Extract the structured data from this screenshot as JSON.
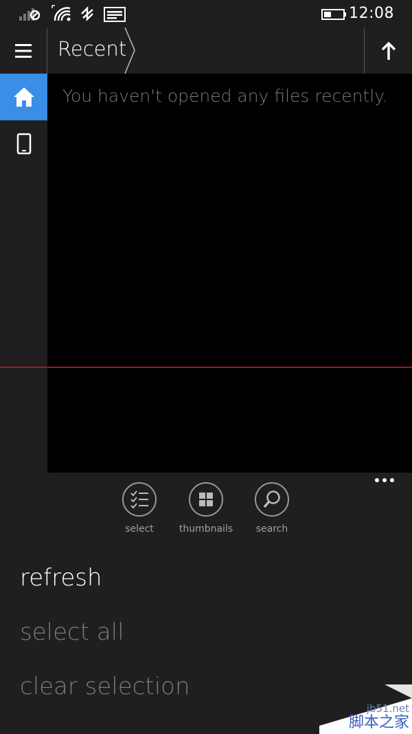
{
  "status_bar": {
    "time": "12:08",
    "icons": [
      "signal-icon",
      "wifi-icon",
      "bluetooth-icon",
      "notification-icon",
      "battery-icon"
    ]
  },
  "header": {
    "breadcrumb": "Recent"
  },
  "sidebar": {
    "items": [
      {
        "icon": "home-icon",
        "active": true
      },
      {
        "icon": "phone-icon",
        "active": false
      }
    ]
  },
  "main": {
    "empty_message": "You haven't opened any files recently."
  },
  "app_bar": {
    "buttons": [
      {
        "icon": "select-icon",
        "label": "select"
      },
      {
        "icon": "thumbnails-icon",
        "label": "thumbnails"
      },
      {
        "icon": "search-icon",
        "label": "search"
      }
    ],
    "menu": [
      {
        "label": "refresh",
        "enabled": true
      },
      {
        "label": "select all",
        "enabled": false
      },
      {
        "label": "clear selection",
        "enabled": false
      }
    ]
  },
  "watermark": {
    "site": "jb51.net",
    "text": "脚本之家"
  },
  "colors": {
    "accent": "#3a8ee6",
    "background": "#1f1f1f",
    "content": "#000000",
    "disabled_text": "#7a7a7a",
    "divider_red": "#b3121a"
  }
}
